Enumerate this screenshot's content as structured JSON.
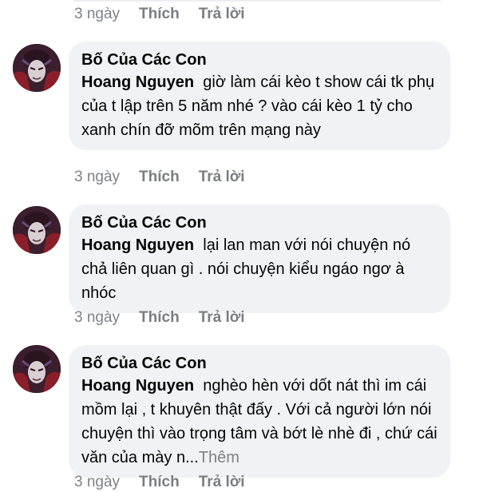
{
  "labels": {
    "time": "3 ngày",
    "like": "Thích",
    "reply": "Trả lời"
  },
  "comments": [
    {
      "author": "Bố Của Các Con",
      "mention": "Hoang Nguyen",
      "text": "giờ làm cái kèo t show cái tk phụ của t lập trên 5 năm nhé ? vào cái kèo 1 tỷ cho xanh chín đỡ mõm trên mạng này"
    },
    {
      "author": "Bố Của Các Con",
      "mention": "Hoang Nguyen",
      "text": "lại lan man với nói chuyện nó chả liên quan gì . nói chuyện kiểu ngáo ngơ à nhóc"
    },
    {
      "author": "Bố Của Các Con",
      "mention": "Hoang Nguyen",
      "text": "nghèo hèn với dốt nát thì im cái mồm lại , t khuyên thật đấy . Với cả người lớn nói chuyện thì vào trọng tâm và bớt lè nhè đi , chứ cái văn của mày n...",
      "more": "Thêm"
    }
  ],
  "colors": {
    "bubble": "#f0f2f5",
    "meta": "#7f8185",
    "text": "#050505"
  }
}
